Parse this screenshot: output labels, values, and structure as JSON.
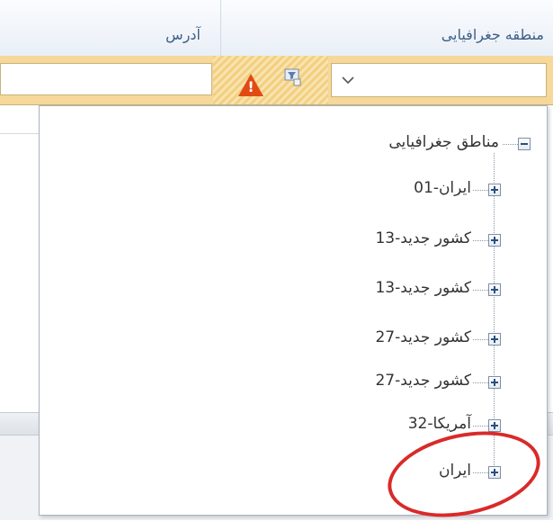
{
  "header": {
    "col_geo_region": "منطقه جغرافیایی",
    "col_address": "آدرس"
  },
  "filter_row": {
    "select_value": "",
    "address_filter_value": ""
  },
  "tree": {
    "root_label": "مناطق جغرافیایی",
    "items": [
      {
        "label": "ایران-01"
      },
      {
        "label": "کشور جدید-13"
      },
      {
        "label": "کشور جدید-13"
      },
      {
        "label": "کشور جدید-27"
      },
      {
        "label": "کشور جدید-27"
      },
      {
        "label": "آمریکا-32"
      },
      {
        "label": "ایران"
      }
    ]
  },
  "annotation": {
    "highlight_color": "#d92a2a"
  },
  "colors": {
    "filter_bg": "#f6d89a",
    "warning": "#e14b13",
    "header_text": "#3e5f86"
  },
  "icons": {
    "warning": "warning-icon",
    "filter": "filter-icon",
    "dropdown": "chevron-down-icon",
    "expand": "plus-box-icon",
    "collapse": "minus-box-icon"
  }
}
